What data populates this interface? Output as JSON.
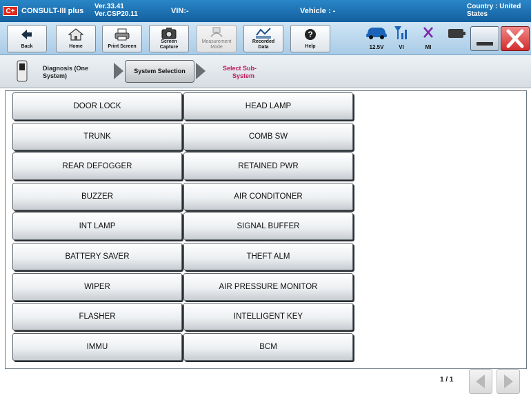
{
  "titlebar": {
    "app_name": "CONSULT-III plus",
    "logo": "C+",
    "version_1": "Ver.33.41",
    "version_2": "Ver.CSP20.11",
    "vin": "VIN:-",
    "vehicle": "Vehicle : -",
    "country_1": "Country : United",
    "country_2": "States"
  },
  "toolbar": {
    "back_label": "Back",
    "home_label": "Home",
    "print_screen_label": "Print Screen",
    "screen_capture_label_1": "Screen",
    "screen_capture_label_2": "Capture",
    "measurement_mode_label_1": "Measurement",
    "measurement_mode_label_2": "Mode",
    "recorded_data_label_1": "Recorded",
    "recorded_data_label_2": "Data",
    "help_label": "Help",
    "battery_voltage": "12.5V",
    "vi_label": "VI",
    "mi_label": "MI"
  },
  "breadcrumb": {
    "step1_line1": "Diagnosis (One",
    "step1_line2": "System)",
    "step2": "System Selection",
    "step3_line1": "Select Sub-",
    "step3_line2": "System"
  },
  "systems": {
    "left": [
      "DOOR LOCK",
      "TRUNK",
      "REAR DEFOGGER",
      "BUZZER",
      "INT LAMP",
      "BATTERY SAVER",
      "WIPER",
      "FLASHER",
      "IMMU"
    ],
    "right": [
      "HEAD LAMP",
      "COMB SW",
      "RETAINED PWR",
      "AIR CONDITONER",
      "SIGNAL BUFFER",
      "THEFT ALM",
      "AIR PRESSURE MONITOR",
      "INTELLIGENT KEY",
      "BCM"
    ]
  },
  "pager": {
    "page_indicator": "1 / 1"
  },
  "colors": {
    "titlebar": "#1f74b6",
    "accent_breadcrumb": "#c0175c",
    "status_icon_blue": "#1a63b8",
    "status_icon_purple": "#7b2aa8",
    "close_red": "#e03a3a"
  },
  "icons": {
    "back": "arrow-left-icon",
    "home": "house-icon",
    "print": "printer-icon",
    "capture": "camera-icon",
    "measure": "gauge-icon",
    "recorded": "data-icon",
    "help": "question-icon"
  }
}
